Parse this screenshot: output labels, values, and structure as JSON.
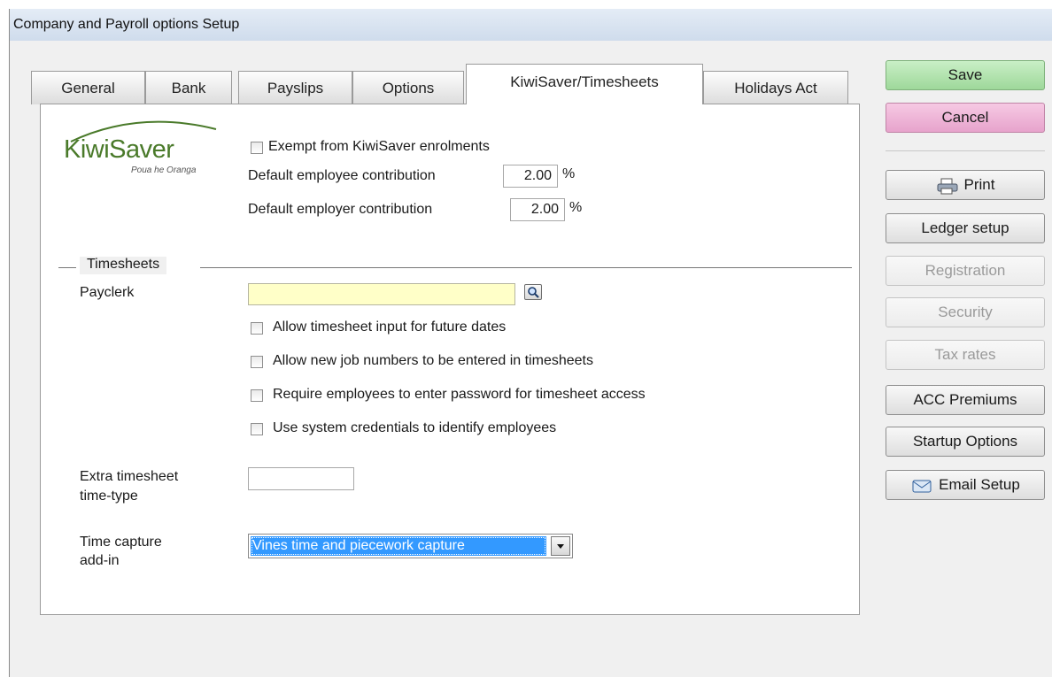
{
  "window": {
    "title": "Company and Payroll options Setup"
  },
  "tabs": [
    {
      "label": "General"
    },
    {
      "label": "Bank"
    },
    {
      "label": "Payslips"
    },
    {
      "label": "Options"
    },
    {
      "label": "KiwiSaver/Timesheets",
      "active": true
    },
    {
      "label": "Holidays Act"
    }
  ],
  "kiwisaver": {
    "logo_main": "KiwiSaver",
    "logo_tagline": "Poua he Oranga",
    "exempt_label": "Exempt from KiwiSaver enrolments",
    "exempt_checked": false,
    "employee_label": "Default employee contribution",
    "employee_value": "2.00",
    "employer_label": "Default employer contribution",
    "employer_value": "2.00",
    "percent": "%"
  },
  "timesheets": {
    "section_title": "Timesheets",
    "payclerk_label": "Payclerk",
    "payclerk_value": "",
    "checkboxes": [
      {
        "label": "Allow timesheet input for future dates",
        "checked": false
      },
      {
        "label": "Allow new job numbers to be entered in timesheets",
        "checked": false
      },
      {
        "label": "Require employees to enter password for timesheet access",
        "checked": false
      },
      {
        "label": "Use system credentials to identify employees",
        "checked": false
      }
    ],
    "extra_label_1": "Extra timesheet",
    "extra_label_2": "time-type",
    "extra_value": "",
    "capture_label_1": "Time capture",
    "capture_label_2": "add-in",
    "capture_value": "Vines time and piecework capture"
  },
  "actions": {
    "save": "Save",
    "cancel": "Cancel",
    "print": "Print",
    "ledger": "Ledger setup",
    "registration": "Registration",
    "security": "Security",
    "tax_rates": "Tax rates",
    "acc": "ACC Premiums",
    "startup": "Startup Options",
    "email": "Email Setup"
  },
  "colors": {
    "payclerk_field_bg": "#ffffc8",
    "dropdown_selected_bg": "#3399ff",
    "logo_green": "#4a7a2a"
  }
}
